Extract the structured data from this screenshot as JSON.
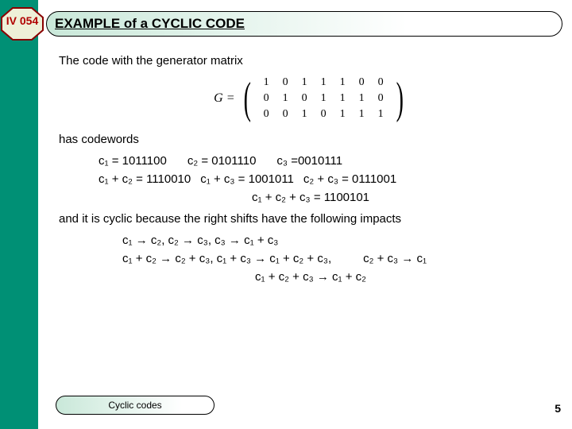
{
  "badge": "IV 054",
  "title": "EXAMPLE of a CYCLIC CODE",
  "intro": "The code with  the generator matrix",
  "matrix_label": "G =",
  "matrix": [
    [
      "1",
      "0",
      "1",
      "1",
      "1",
      "0",
      "0"
    ],
    [
      "0",
      "1",
      "0",
      "1",
      "1",
      "1",
      "0"
    ],
    [
      "0",
      "0",
      "1",
      "0",
      "1",
      "1",
      "1"
    ]
  ],
  "has_codewords": "has codewords",
  "codewords_row1": {
    "a": "c₁ = 1011100",
    "b": "c₂ = 0101110",
    "c": "c₃ =0010111"
  },
  "codewords_row2": {
    "a": "c₁ + c₂ = 1110010",
    "b": "c₁ + c₃ = 1001011",
    "c": "c₂ + c₃ = 0111001"
  },
  "codewords_row3": "c₁ + c₂ + c₃ = 1100101",
  "cyclic_line": "and it is cyclic because the right shifts have the following impacts",
  "shifts_row1": "c₁ → c₂, c₂ → c₃, c₃ → c₁ + c₃",
  "shifts_row2a": "c₁ + c₂ → c₂ + c₃, c₁ + c₃ → c₁ + c₂ + c₃,",
  "shifts_row2b": "c₂ + c₃ → c₁",
  "shifts_row3": "c₁ + c₂ + c₃ → c₁ + c₂",
  "footer": "Cyclic codes",
  "page": "5"
}
